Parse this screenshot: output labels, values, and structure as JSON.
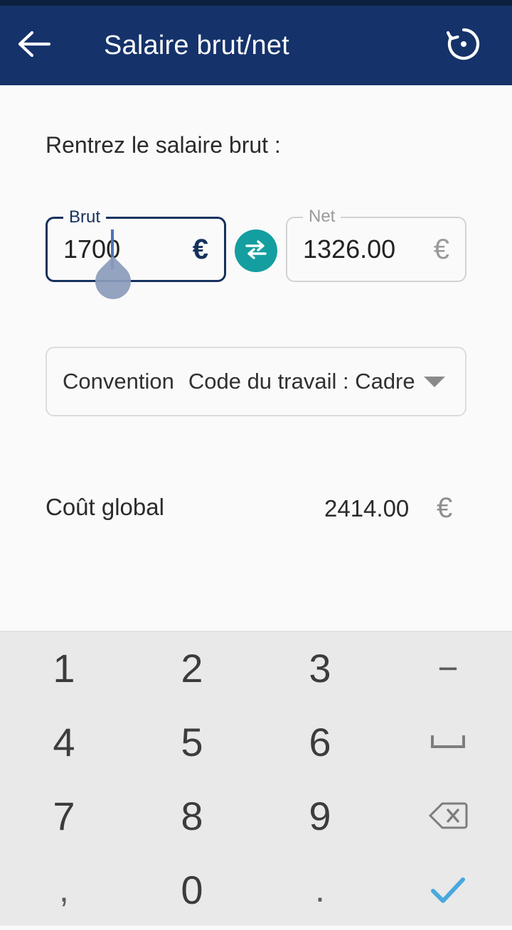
{
  "appbar": {
    "title": "Salaire brut/net",
    "back_icon": "arrow-left-icon",
    "restore_icon": "restore-history-icon",
    "background_color": "#15326a"
  },
  "content": {
    "prompt": "Rentrez le salaire brut :",
    "gross_field": {
      "label": "Brut",
      "value": "1700",
      "currency": "€",
      "focused": true,
      "accent_color": "#16325c"
    },
    "swap_button": {
      "icon": "swap-horizontal-icon",
      "color": "#149ea0"
    },
    "net_field": {
      "label": "Net",
      "value": "1326.00",
      "currency": "€",
      "focused": false,
      "border_color": "#d2d2d2"
    },
    "convention_dropdown": {
      "label": "Convention",
      "value": "Code du travail : Cadre",
      "arrow_icon": "chevron-down-icon"
    },
    "total": {
      "label": "Coût global",
      "value": "2414.00",
      "currency": "€"
    }
  },
  "keyboard": {
    "background_color": "#e9e9e9",
    "keys": [
      {
        "label": "1",
        "name": "key-1",
        "type": "digit"
      },
      {
        "label": "2",
        "name": "key-2",
        "type": "digit"
      },
      {
        "label": "3",
        "name": "key-3",
        "type": "digit"
      },
      {
        "label": "−",
        "name": "key-minus",
        "type": "symbol"
      },
      {
        "label": "4",
        "name": "key-4",
        "type": "digit"
      },
      {
        "label": "5",
        "name": "key-5",
        "type": "digit"
      },
      {
        "label": "6",
        "name": "key-6",
        "type": "digit"
      },
      {
        "label": "⎵",
        "name": "key-space",
        "type": "icon-space"
      },
      {
        "label": "7",
        "name": "key-7",
        "type": "digit"
      },
      {
        "label": "8",
        "name": "key-8",
        "type": "digit"
      },
      {
        "label": "9",
        "name": "key-9",
        "type": "digit"
      },
      {
        "label": "",
        "name": "key-backspace",
        "type": "icon-backspace"
      },
      {
        "label": ",",
        "name": "key-comma",
        "type": "symbol"
      },
      {
        "label": "0",
        "name": "key-0",
        "type": "digit"
      },
      {
        "label": ".",
        "name": "key-period",
        "type": "symbol"
      },
      {
        "label": "",
        "name": "key-enter",
        "type": "icon-check"
      }
    ],
    "enter_color": "#4aa8dd"
  }
}
